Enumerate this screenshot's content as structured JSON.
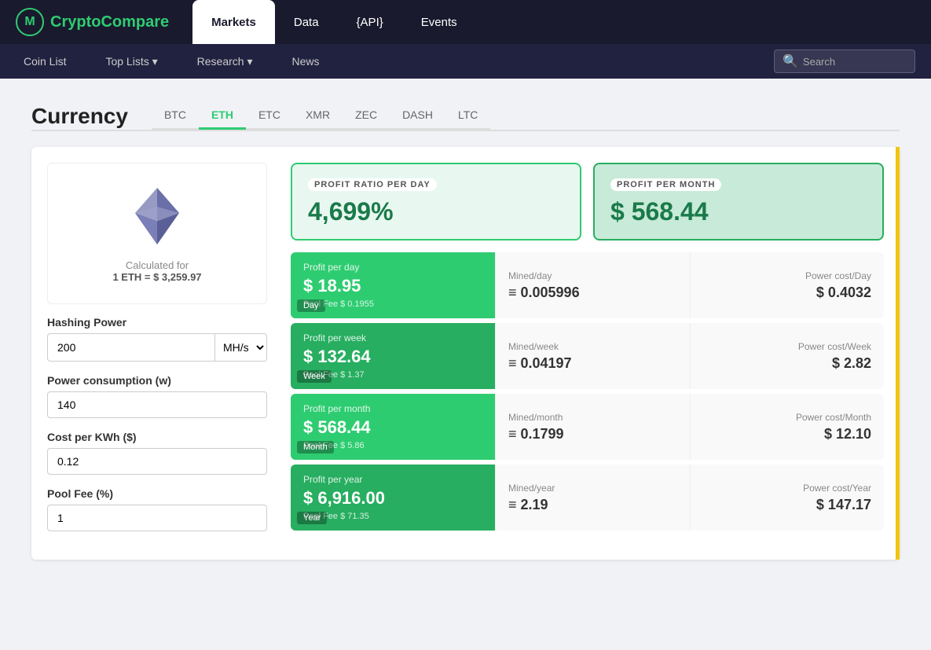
{
  "site": {
    "logo_icon": "M",
    "logo_name_part1": "Crypto",
    "logo_name_part2": "Compare"
  },
  "top_nav": {
    "items": [
      {
        "label": "Markets",
        "active": true
      },
      {
        "label": "Data",
        "active": false
      },
      {
        "label": "{API}",
        "active": false
      },
      {
        "label": "Events",
        "active": false
      }
    ]
  },
  "sub_nav": {
    "items": [
      {
        "label": "Coin List"
      },
      {
        "label": "Top Lists ▾"
      },
      {
        "label": "Research ▾"
      },
      {
        "label": "News"
      }
    ],
    "search_placeholder": "Search"
  },
  "currency": {
    "title": "Currency",
    "tabs": [
      {
        "label": "BTC",
        "active": false
      },
      {
        "label": "ETH",
        "active": true
      },
      {
        "label": "ETC",
        "active": false
      },
      {
        "label": "XMR",
        "active": false
      },
      {
        "label": "ZEC",
        "active": false
      },
      {
        "label": "DASH",
        "active": false
      },
      {
        "label": "LTC",
        "active": false
      }
    ],
    "calc_label": "Calculated for",
    "calc_value": "1 ETH = $ 3,259.97"
  },
  "form": {
    "hashing_power_label": "Hashing Power",
    "hashing_power_value": "200",
    "hashing_unit": "MH/s",
    "power_consumption_label": "Power consumption (w)",
    "power_consumption_value": "140",
    "cost_per_kwh_label": "Cost per KWh ($)",
    "cost_per_kwh_value": "0.12",
    "pool_fee_label": "Pool Fee (%)",
    "pool_fee_value": "1"
  },
  "summary": {
    "ratio_label": "PROFIT RATIO PER DAY",
    "ratio_value": "4,699%",
    "profit_label": "PROFIT PER MONTH",
    "profit_value": "$ 568.44"
  },
  "stats": [
    {
      "period": "Day",
      "main_label": "Profit per day",
      "main_value": "$ 18.95",
      "pool_fee": "Pool Fee $ 0.1955",
      "mined_label": "Mined/day",
      "mined_value": "≡ 0.005996",
      "power_label": "Power cost/Day",
      "power_value": "$ 0.4032"
    },
    {
      "period": "Week",
      "main_label": "Profit per week",
      "main_value": "$ 132.64",
      "pool_fee": "Pool Fee $ 1.37",
      "mined_label": "Mined/week",
      "mined_value": "≡ 0.04197",
      "power_label": "Power cost/Week",
      "power_value": "$ 2.82"
    },
    {
      "period": "Month",
      "main_label": "Profit per month",
      "main_value": "$ 568.44",
      "pool_fee": "Pool Fee $ 5.86",
      "mined_label": "Mined/month",
      "mined_value": "≡ 0.1799",
      "power_label": "Power cost/Month",
      "power_value": "$ 12.10"
    },
    {
      "period": "Year",
      "main_label": "Profit per year",
      "main_value": "$ 6,916.00",
      "pool_fee": "Pool Fee $ 71.35",
      "mined_label": "Mined/year",
      "mined_value": "≡ 2.19",
      "power_label": "Power cost/Year",
      "power_value": "$ 147.17"
    }
  ]
}
